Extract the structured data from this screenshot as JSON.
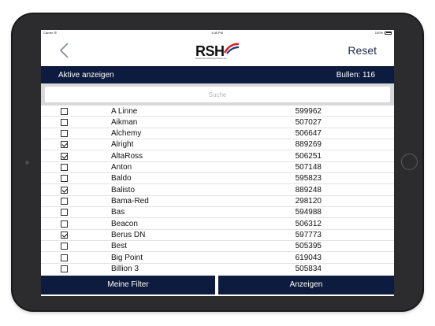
{
  "status": {
    "carrier": "Carrier ☰",
    "time": "1:08 PM",
    "battery": "100%"
  },
  "navbar": {
    "logo_text": "RSH",
    "logo_sub": "Rinderunion Schleswig-Holstein eG",
    "reset_label": "Reset",
    "brand_red": "#d6262e",
    "brand_blue": "#1c3f7a"
  },
  "filter": {
    "active_label": "Aktive anzeigen",
    "count_label": "Bullen: 116"
  },
  "search": {
    "placeholder": "Suche",
    "value": ""
  },
  "list": {
    "rows": [
      {
        "name": "A Linne",
        "id": "599962",
        "checked": false
      },
      {
        "name": "Aikman",
        "id": "507027",
        "checked": false
      },
      {
        "name": "Alchemy",
        "id": "506647",
        "checked": false
      },
      {
        "name": "Alright",
        "id": "889269",
        "checked": true
      },
      {
        "name": "AltaRoss",
        "id": "506251",
        "checked": true
      },
      {
        "name": "Anton",
        "id": "507148",
        "checked": false
      },
      {
        "name": "Baldo",
        "id": "595823",
        "checked": false
      },
      {
        "name": "Balisto",
        "id": "889248",
        "checked": true
      },
      {
        "name": "Bama-Red",
        "id": "298120",
        "checked": false
      },
      {
        "name": "Bas",
        "id": "594988",
        "checked": false
      },
      {
        "name": "Beacon",
        "id": "506312",
        "checked": false
      },
      {
        "name": "Berus DN",
        "id": "597773",
        "checked": true
      },
      {
        "name": "Best",
        "id": "505395",
        "checked": false
      },
      {
        "name": "Big Point",
        "id": "619043",
        "checked": false
      },
      {
        "name": "Billion 3",
        "id": "505834",
        "checked": false
      }
    ]
  },
  "bottom": {
    "filter_label": "Meine Filter",
    "show_label": "Anzeigen"
  },
  "colors": {
    "navy": "#0d1b3e",
    "search_bg": "#d9d9d9"
  }
}
